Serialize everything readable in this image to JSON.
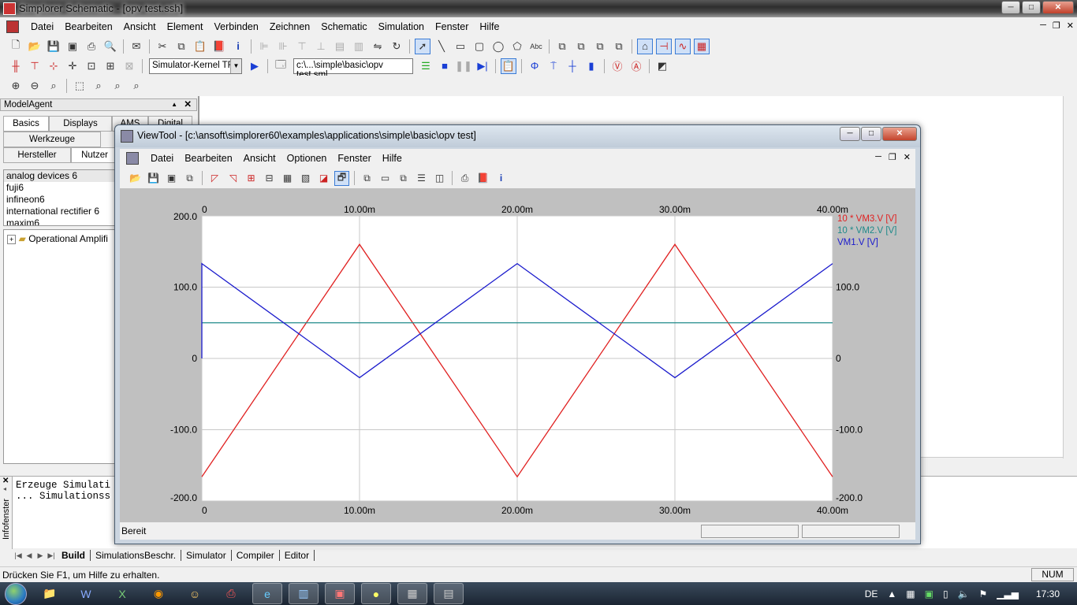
{
  "window": {
    "title": "Simplorer Schematic - [opv test.ssh]",
    "menu": [
      "Datei",
      "Bearbeiten",
      "Ansicht",
      "Element",
      "Verbinden",
      "Zeichnen",
      "Schematic",
      "Simulation",
      "Fenster",
      "Hilfe"
    ]
  },
  "toolbar": {
    "kernel_select": "Simulator-Kernel TR",
    "sim_path": "c:\\...\\simple\\basic\\opv test.sml"
  },
  "model_agent": {
    "title": "ModelAgent",
    "tabs_row1": [
      "Basics",
      "Displays",
      "AMS",
      "Digital"
    ],
    "tabs_row2": [
      "Werkzeuge"
    ],
    "tabs_row3": [
      "Hersteller",
      "Nutzer"
    ],
    "list": [
      "analog devices 6",
      "fuji6",
      "infineon6",
      "international rectifier 6",
      "maxim6"
    ],
    "tree_item": "Operational Amplifi"
  },
  "info_window": {
    "label": "Infofenster",
    "lines": [
      "Erzeuge Simulati",
      "... Simulationss"
    ],
    "tabs": [
      "Build",
      "SimulationsBeschr.",
      "Simulator",
      "Compiler",
      "Editor"
    ]
  },
  "status": {
    "help": "Drücken Sie F1, um Hilfe zu erhalten.",
    "num": "NUM"
  },
  "taskbar": {
    "lang": "DE",
    "time": "17:30"
  },
  "viewtool": {
    "title": "ViewTool - [c:\\ansoft\\simplorer60\\examples\\applications\\simple\\basic\\opv test]",
    "menu": [
      "Datei",
      "Bearbeiten",
      "Ansicht",
      "Optionen",
      "Fenster",
      "Hilfe"
    ],
    "status": "Bereit"
  },
  "chart_data": {
    "type": "line",
    "xlim": [
      0,
      0.04
    ],
    "ylim": [
      -200,
      200
    ],
    "x_ticks": [
      "0",
      "10.00m",
      "20.00m",
      "30.00m",
      "40.00m"
    ],
    "y_ticks_left": [
      "200.0",
      "100.0",
      "0",
      "-100.0",
      "-200.0"
    ],
    "y_ticks_right": [
      "100.0",
      "0",
      "-100.0",
      "-200.0"
    ],
    "grid": true,
    "legend_position": "right",
    "series": [
      {
        "name": "10 * VM3.V [V]",
        "color": "#e02020",
        "x": [
          0,
          0.01,
          0.02,
          0.03,
          0.04
        ],
        "y": [
          -166,
          160,
          -166,
          160,
          -166
        ]
      },
      {
        "name": "10 * VM2.V [V]",
        "color": "#1f8a8a",
        "x": [
          0,
          0.04
        ],
        "y": [
          50,
          50
        ]
      },
      {
        "name": "VM1.V [V]",
        "color": "#1a1acc",
        "x": [
          0,
          0,
          0.01,
          0.02,
          0.03,
          0.04
        ],
        "y": [
          0,
          133,
          -27,
          133,
          -27,
          133
        ]
      }
    ]
  }
}
